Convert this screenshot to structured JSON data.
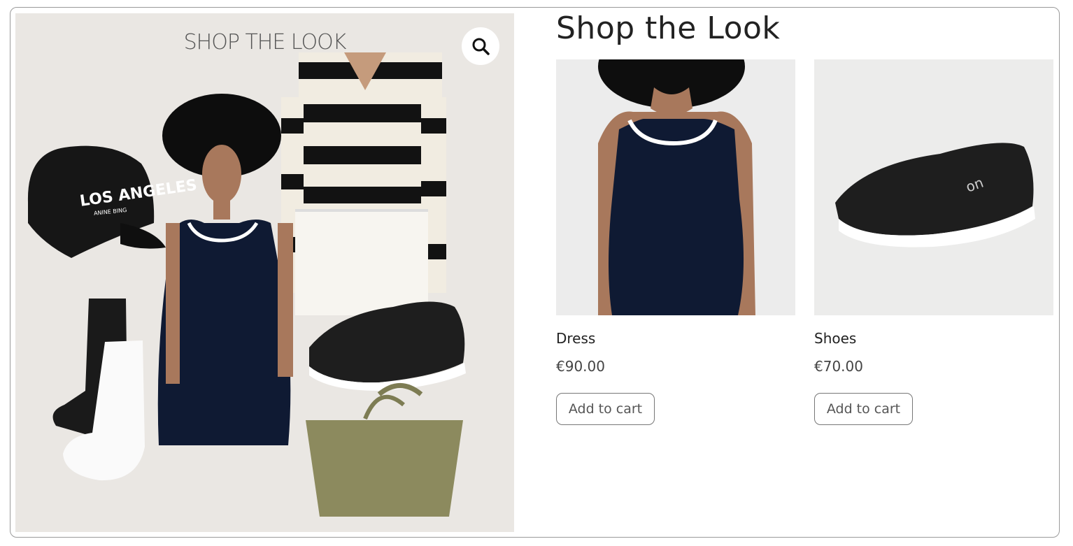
{
  "hero": {
    "title": "SHOP THE LOOK",
    "cap_text_main": "LOS ANGELES",
    "cap_text_sub": "ANINE BING",
    "zoom_icon": "magnifier-icon"
  },
  "section": {
    "title": "Shop the Look"
  },
  "products": [
    {
      "name": "Dress",
      "price": "€90.00",
      "cta": "Add to cart"
    },
    {
      "name": "Shoes",
      "price": "€70.00",
      "cta": "Add to cart"
    }
  ],
  "colors": {
    "navy": "#0f1a33",
    "beige_bg": "#eae7e3",
    "olive": "#8a8a5c"
  }
}
